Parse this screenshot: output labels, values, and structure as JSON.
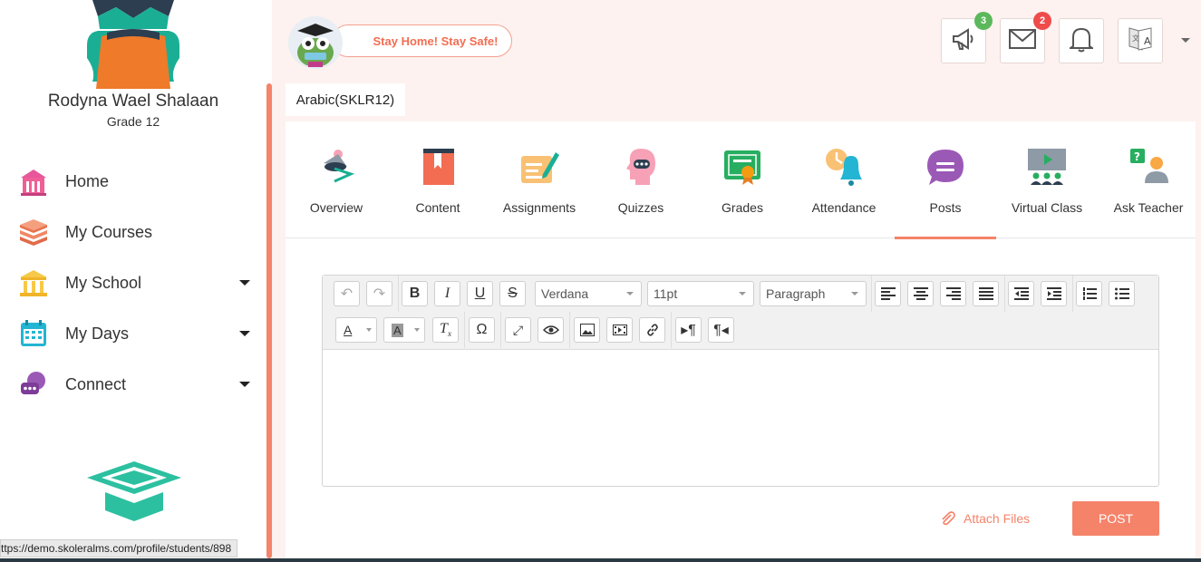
{
  "user": {
    "name": "Rodyna Wael Shalaan",
    "grade": "Grade 12"
  },
  "nav": {
    "items": [
      {
        "label": "Home",
        "icon": "home-icon",
        "caret": false
      },
      {
        "label": "My Courses",
        "icon": "books-icon",
        "caret": false
      },
      {
        "label": "My School",
        "icon": "school-icon",
        "caret": true
      },
      {
        "label": "My Days",
        "icon": "calendar-icon",
        "caret": true
      },
      {
        "label": "Connect",
        "icon": "chat-icon",
        "caret": true
      }
    ]
  },
  "status_url": "ttps://demo.skoleralms.com/profile/students/898",
  "header": {
    "banner": "Stay Home! Stay Safe!",
    "announcements_count": "3",
    "messages_count": "2"
  },
  "course": {
    "name": "Arabic(SKLR12)"
  },
  "tabs": [
    {
      "label": "Overview",
      "icon": "overview-icon"
    },
    {
      "label": "Content",
      "icon": "content-icon"
    },
    {
      "label": "Assignments",
      "icon": "assignments-icon"
    },
    {
      "label": "Quizzes",
      "icon": "quizzes-icon"
    },
    {
      "label": "Grades",
      "icon": "grades-icon"
    },
    {
      "label": "Attendance",
      "icon": "attendance-icon"
    },
    {
      "label": "Posts",
      "icon": "posts-icon",
      "active": true
    },
    {
      "label": "Virtual Class",
      "icon": "virtual-class-icon"
    },
    {
      "label": "Ask Teacher",
      "icon": "ask-teacher-icon"
    }
  ],
  "editor": {
    "font_family": "Verdana",
    "font_size": "11pt",
    "block_format": "Paragraph"
  },
  "actions": {
    "attach_label": "Attach Files",
    "post_label": "POST"
  },
  "colors": {
    "accent": "#f5836a",
    "badge_green": "#5cb85c",
    "badge_red": "#ef4b4b"
  }
}
